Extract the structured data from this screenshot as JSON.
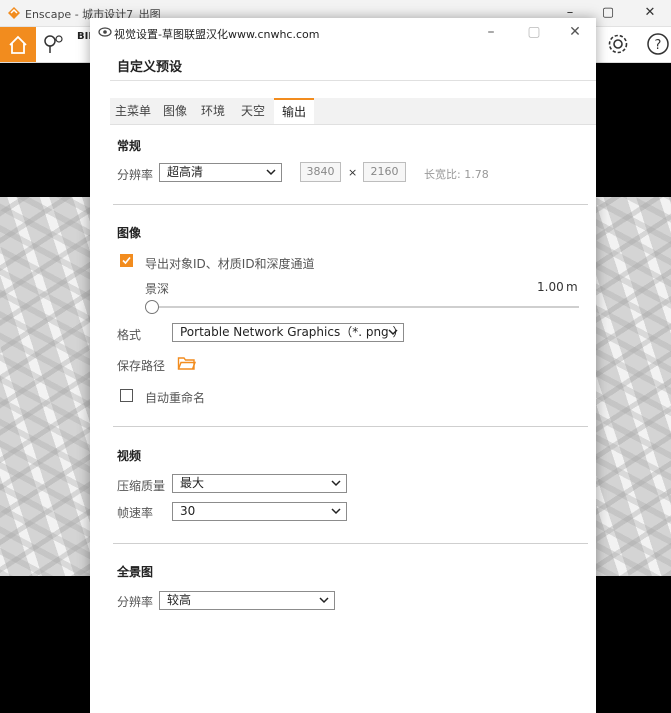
{
  "app": {
    "title": "Enscape - 城市设计7_出图",
    "bim_label": "BIM"
  },
  "dialog": {
    "title": "视觉设置-草图联盟汉化www.cnwhc.com",
    "preset_title": "自定义预设",
    "tabs": [
      {
        "label": "主菜单",
        "active": false
      },
      {
        "label": "图像",
        "active": false
      },
      {
        "label": "环境",
        "active": false
      },
      {
        "label": "天空",
        "active": false
      },
      {
        "label": "输出",
        "active": true
      }
    ],
    "general": {
      "title": "常规",
      "resolution_label": "分辨率",
      "resolution_value": "超高清",
      "width": "3840",
      "times": "×",
      "height": "2160",
      "aspect": "长宽比: 1.78"
    },
    "image": {
      "title": "图像",
      "export_ids_label": "导出对象ID、材质ID和深度通道",
      "export_ids_checked": true,
      "depth_label": "景深",
      "depth_value": "1.00",
      "depth_unit": "m",
      "depth_slider_fraction": 0.0,
      "format_label": "格式",
      "format_value": "Portable Network Graphics（*. png ）",
      "save_path_label": "保存路径",
      "auto_rename_label": "自动重命名",
      "auto_rename_checked": false
    },
    "video": {
      "title": "视频",
      "quality_label": "压缩质量",
      "quality_value": "最大",
      "fps_label": "帧速率",
      "fps_value": "30"
    },
    "panorama": {
      "title": "全景图",
      "resolution_label": "分辨率",
      "resolution_value": "较高"
    }
  },
  "colors": {
    "accent": "#f28c1e",
    "background": "#000000",
    "panel": "#ffffff"
  },
  "icons": [
    "enscape-logo-icon",
    "minimize-icon",
    "maximize-icon",
    "close-icon",
    "home-icon",
    "map-pin-icon",
    "gear-icon",
    "help-icon",
    "eye-icon",
    "folder-icon",
    "chevron-left-icon",
    "chevron-down-icon"
  ]
}
